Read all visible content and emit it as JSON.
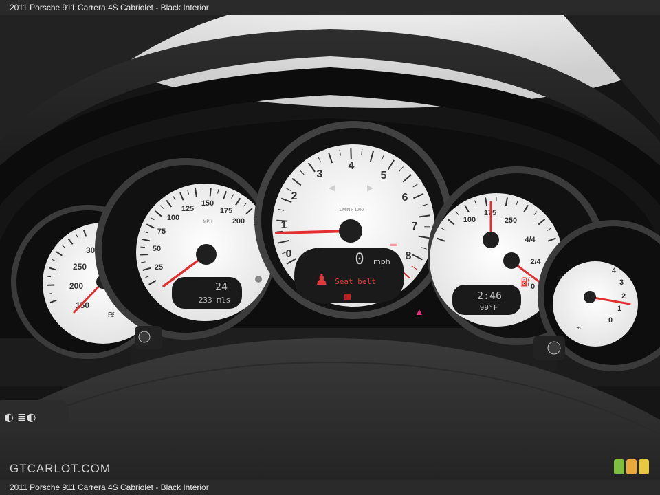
{
  "caption": "2011 Porsche 911 Carrera 4S Cabriolet - Black Interior",
  "watermark": "GTCARLOT.COM",
  "zoom_colors": [
    "#7fbf3f",
    "#e6a93a",
    "#e8c840"
  ],
  "gauges": {
    "coolant": {
      "ticks": [
        "300",
        "250",
        "200",
        "150"
      ]
    },
    "speedometer": {
      "ticks": [
        "25",
        "50",
        "75",
        "100",
        "125",
        "150",
        "175",
        "200"
      ],
      "units": "MPH",
      "trip_display": "24",
      "odometer_display": "233 mls"
    },
    "tachometer": {
      "ticks": [
        "0",
        "1",
        "2",
        "3",
        "4",
        "5",
        "6",
        "7",
        "8"
      ],
      "units_label": "1/MIN x 1000",
      "speed_value": "0",
      "speed_units": "mph",
      "warning_text": "Seat belt"
    },
    "oil_temp_fuel": {
      "oil_ticks": [
        "100",
        "175",
        "250"
      ],
      "fuel_ticks": [
        "4/4",
        "2/4",
        "0"
      ],
      "time_display": "2:46",
      "temp_display": "99°F"
    },
    "oil_pressure": {
      "ticks": [
        "0",
        "1",
        "2",
        "3",
        "4"
      ]
    }
  }
}
